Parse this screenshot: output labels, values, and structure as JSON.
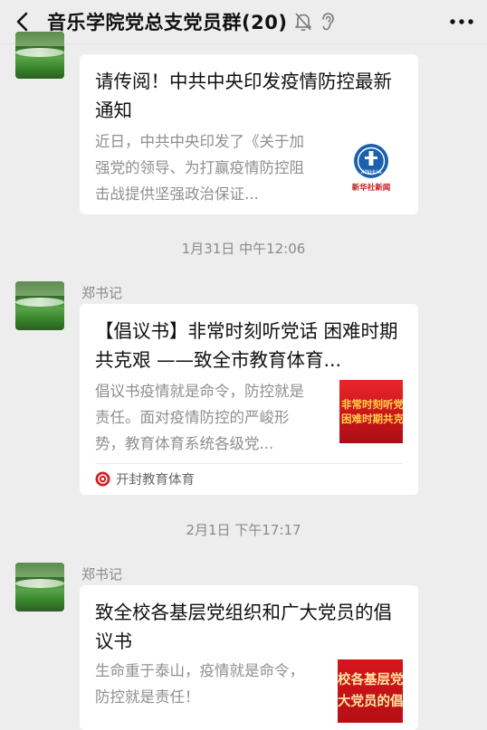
{
  "header": {
    "title": "音乐学院党总支党员群(20)",
    "icons": [
      "back-arrow-icon",
      "mute-bell-icon",
      "earpiece-icon",
      "more-icon"
    ]
  },
  "messages": [
    {
      "sender": "",
      "title": "请传阅！中共中央印发疫情防控最新通知",
      "desc": "近日，中共中央印发了《关于加强党的领导、为打赢疫情防控阻击战提供坚强政治保证...",
      "thumb_label": "新华社新闻",
      "thumb_logo": "XINHUA"
    },
    {
      "timestamp": "1月31日 中午12:06",
      "sender": "郑书记",
      "title": "【倡议书】非常时刻听党话 困难时期共克艰 ——致全市教育体育...",
      "desc": "倡议书疫情就是命令，防控就是责任。面对疫情防控的严峻形势，教育体育系统各级党...",
      "thumb_lines": [
        "非常时刻听党",
        "困难时期共克"
      ],
      "source": "开封教育体育"
    },
    {
      "timestamp": "2月1日 下午17:17",
      "sender": "郑书记",
      "title": "致全校各基层党组织和广大党员的倡议书",
      "desc": "生命重于泰山，疫情就是命令，防控就是责任！",
      "thumb_lines": [
        "校各基层党",
        "大党员的倡"
      ]
    }
  ],
  "colors": {
    "background": "#ededed",
    "card": "#ffffff",
    "meta_text": "#8a8a8a",
    "thumb_red": "#d4161c"
  }
}
